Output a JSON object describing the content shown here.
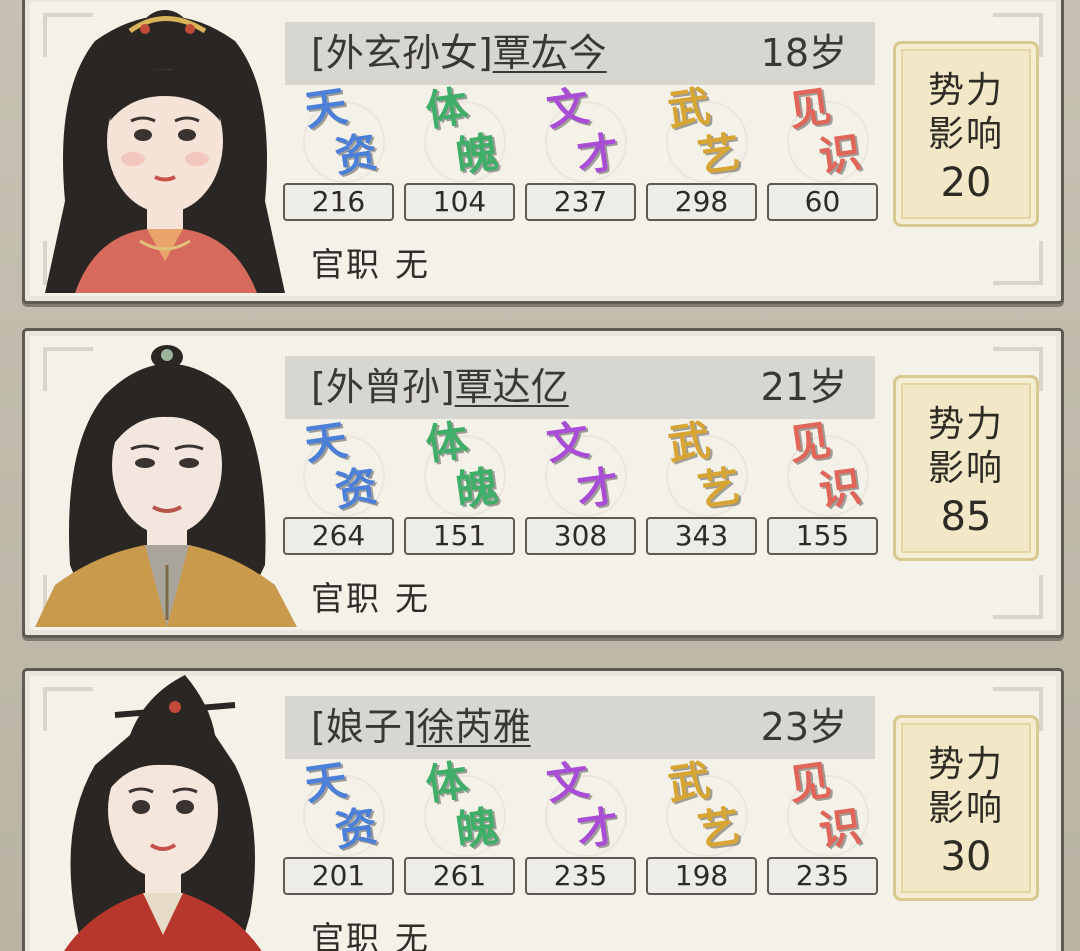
{
  "characters": [
    {
      "relation": "[外玄孙女]",
      "name": "覃厷今",
      "age": "18岁",
      "stats": [
        {
          "top": "天",
          "bottom": "资",
          "value": "216",
          "color": "#4b7fd8"
        },
        {
          "top": "体",
          "bottom": "魄",
          "value": "104",
          "color": "#3fae68"
        },
        {
          "top": "文",
          "bottom": "才",
          "value": "237",
          "color": "#a94cd6"
        },
        {
          "top": "武",
          "bottom": "艺",
          "value": "298",
          "color": "#d7a534"
        },
        {
          "top": "见",
          "bottom": "识",
          "value": "60",
          "color": "#e0665a"
        }
      ],
      "office_label": "官职",
      "office_value": "无",
      "influence_l1": "势力",
      "influence_l2": "影响",
      "influence_value": "20"
    },
    {
      "relation": "[外曾孙]",
      "name": "覃达亿",
      "age": "21岁",
      "stats": [
        {
          "top": "天",
          "bottom": "资",
          "value": "264",
          "color": "#4b7fd8"
        },
        {
          "top": "体",
          "bottom": "魄",
          "value": "151",
          "color": "#3fae68"
        },
        {
          "top": "文",
          "bottom": "才",
          "value": "308",
          "color": "#a94cd6"
        },
        {
          "top": "武",
          "bottom": "艺",
          "value": "343",
          "color": "#d7a534"
        },
        {
          "top": "见",
          "bottom": "识",
          "value": "155",
          "color": "#e0665a"
        }
      ],
      "office_label": "官职",
      "office_value": "无",
      "influence_l1": "势力",
      "influence_l2": "影响",
      "influence_value": "85"
    },
    {
      "relation": "[娘子]",
      "name": "徐芮雅",
      "age": "23岁",
      "stats": [
        {
          "top": "天",
          "bottom": "资",
          "value": "201",
          "color": "#4b7fd8"
        },
        {
          "top": "体",
          "bottom": "魄",
          "value": "261",
          "color": "#3fae68"
        },
        {
          "top": "文",
          "bottom": "才",
          "value": "235",
          "color": "#a94cd6"
        },
        {
          "top": "武",
          "bottom": "艺",
          "value": "198",
          "color": "#d7a534"
        },
        {
          "top": "见",
          "bottom": "识",
          "value": "235",
          "color": "#e0665a"
        }
      ],
      "office_label": "官职",
      "office_value": "无",
      "influence_l1": "势力",
      "influence_l2": "影响",
      "influence_value": "30"
    }
  ]
}
